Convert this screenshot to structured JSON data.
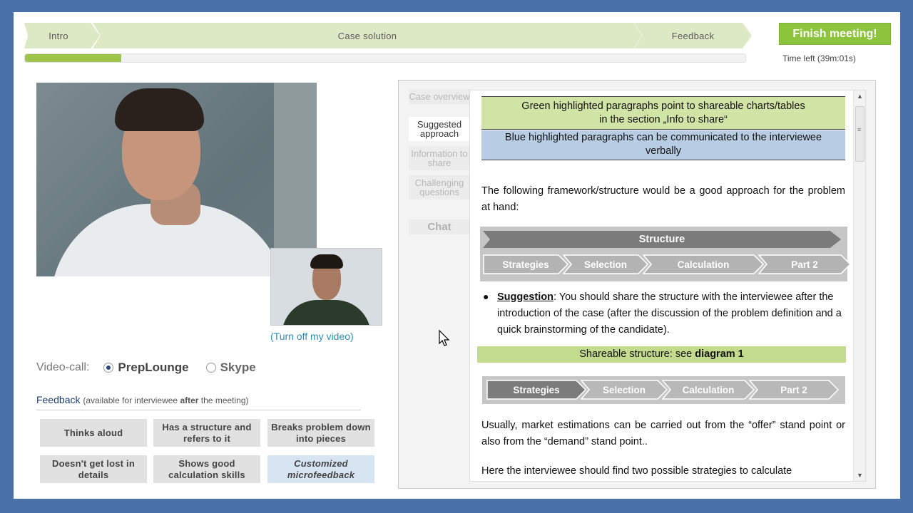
{
  "steps": [
    "Intro",
    "Case solution",
    "Feedback"
  ],
  "progress": 0.134,
  "finish_label": "Finish meeting!",
  "time_left": "Time left (39m:01s)",
  "turn_off_video": "(Turn off my video)",
  "videocall": {
    "label": "Video-call:",
    "options": [
      "PrepLounge",
      "Skype"
    ],
    "selected": "PrepLounge"
  },
  "feedback": {
    "title": "Feedback",
    "note_pre": "(available for interviewee ",
    "note_bold": "after",
    "note_post": " the meeting)",
    "buttons": [
      "Thinks aloud",
      "Has a structure and refers to it",
      "Breaks problem down into pieces",
      "Doesn't get lost in details",
      "Shows good calculation skills",
      "Customized microfeedback"
    ]
  },
  "side_tabs": [
    {
      "label": "Case overview"
    },
    {
      "label": "Suggested approach"
    },
    {
      "label": "Information to share"
    },
    {
      "label": "Challenging questions"
    },
    {
      "label": "Chat"
    }
  ],
  "content": {
    "legend_green_1": "Green highlighted paragraphs point to shareable charts/tables",
    "legend_green_2": "in the section „Info to share“",
    "legend_blue_1": "Blue highlighted paragraphs can be communicated to the interviewee",
    "legend_blue_2": "verbally",
    "intro": "The following framework/structure would be a good approach for the problem at hand:",
    "structure_title": "Structure",
    "structure_items": [
      "Strategies",
      "Selection",
      "Calculation",
      "Part 2"
    ],
    "suggestion_label": "Suggestion",
    "suggestion_text": ": You should share the structure with the interviewee after the introduction of the case (after the discussion of the problem definition and a quick brainstorming of the candidate).",
    "shareable_pre": "Shareable structure: see ",
    "shareable_bold": "diagram 1",
    "diagram_items": [
      "Strategies",
      "Selection",
      "Calculation",
      "Part 2"
    ],
    "para2": "Usually, market estimations can be carried out from the “offer” stand point or also from the “demand” stand point..",
    "para3": "Here the interviewee should find two possible strategies to calculate"
  },
  "colors": {
    "accent_green": "#8cc43d",
    "progress_green": "#9ec54a",
    "link_blue": "#2e8fb6",
    "frame_blue": "#4a72a8"
  }
}
